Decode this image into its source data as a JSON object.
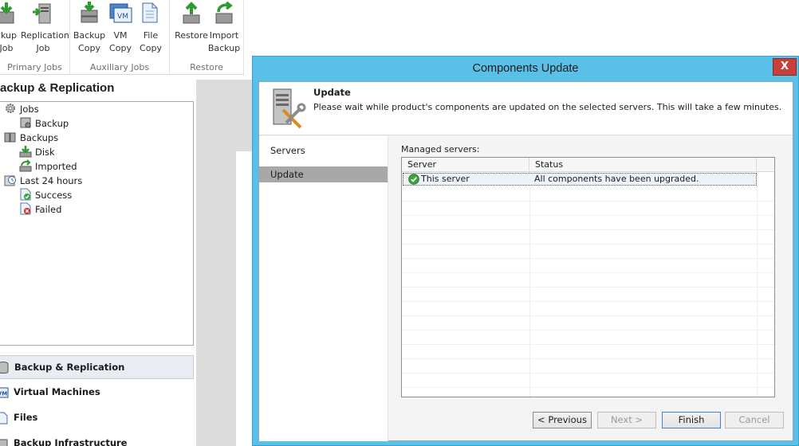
{
  "ribbon": {
    "groups": [
      {
        "label": "Primary Jobs",
        "buttons": [
          {
            "label": "ckup\nJob"
          },
          {
            "label": "Replication\nJob"
          }
        ]
      },
      {
        "label": "Auxiliary Jobs",
        "buttons": [
          {
            "label": "Backup\nCopy"
          },
          {
            "label": "VM\nCopy"
          },
          {
            "label": "File\nCopy"
          }
        ]
      },
      {
        "label": "Restore",
        "buttons": [
          {
            "label": "Restore"
          },
          {
            "label": "Import\nBackup"
          }
        ]
      }
    ],
    "vm_icon_text": "VM"
  },
  "nav": {
    "title": "ackup & Replication",
    "tree": [
      {
        "label": "Jobs",
        "icon": "gear-icon"
      },
      {
        "label": "Backup",
        "icon": "backup-job-icon"
      },
      {
        "label": "Backups",
        "icon": "backups-icon"
      },
      {
        "label": "Disk",
        "icon": "disk-icon"
      },
      {
        "label": "Imported",
        "icon": "imported-icon"
      },
      {
        "label": "Last 24 hours",
        "icon": "history-icon"
      },
      {
        "label": "Success",
        "icon": "success-icon"
      },
      {
        "label": "Failed",
        "icon": "failed-icon"
      }
    ],
    "sections": [
      {
        "label": "Backup & Replication",
        "icon": "database-icon"
      },
      {
        "label": "Virtual Machines",
        "icon": "vm-icon",
        "icon_text": "VM"
      },
      {
        "label": "Files",
        "icon": "file-icon"
      },
      {
        "label": "Backup Infrastructure",
        "icon": "infrastructure-icon"
      }
    ]
  },
  "dialog": {
    "title": "Components Update",
    "close_label": "X",
    "header_title": "Update",
    "header_desc": "Please wait while product's components are updated on the selected servers. This will take a few minutes.",
    "steps": [
      {
        "label": "Servers"
      },
      {
        "label": "Update"
      }
    ],
    "managed_label": "Managed servers:",
    "columns": [
      "Server",
      "Status"
    ],
    "rows": [
      {
        "server": "This server",
        "status": "All components have been upgraded."
      }
    ],
    "buttons": {
      "previous": "< Previous",
      "next": "Next >",
      "finish": "Finish",
      "cancel": "Cancel"
    }
  },
  "colors": {
    "dialog_frame": "#5bc0e8",
    "close_button": "#c7403a",
    "active_step": "#a8a8a8",
    "success_green": "#3aa63a"
  }
}
